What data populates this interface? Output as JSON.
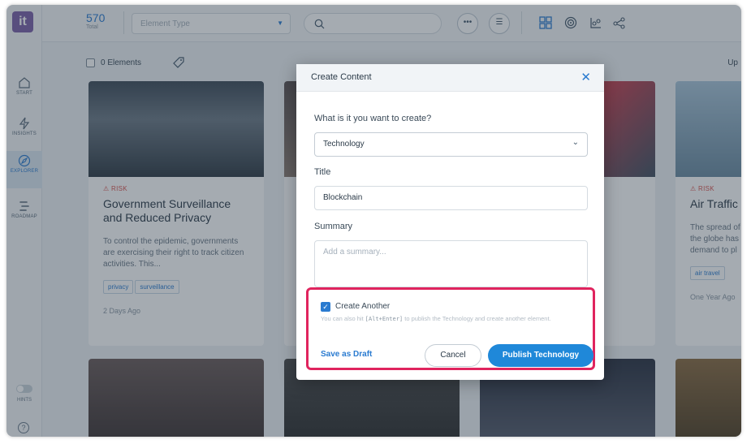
{
  "app": {
    "logo": "it"
  },
  "sidebar": {
    "items": [
      {
        "label": "START",
        "icon": "home-icon"
      },
      {
        "label": "INSIGHTS",
        "icon": "lightning-icon"
      },
      {
        "label": "EXPLORER",
        "icon": "compass-icon"
      },
      {
        "label": "ROADMAP",
        "icon": "roadmap-icon"
      }
    ],
    "hints_label": "HINTS",
    "help_label": "?"
  },
  "topbar": {
    "count": "570",
    "count_label": "Total",
    "element_type_placeholder": "Element Type"
  },
  "toolbar": {
    "elements_label": "0 Elements",
    "right_text": "Up"
  },
  "cards": [
    {
      "category": "RISK",
      "title": "Government Surveillance and Reduced Privacy",
      "description": "To control the epidemic, governments are exercising their right to track citizen activities. This...",
      "tags": [
        "privacy",
        "surveillance"
      ],
      "date": "2 Days Ago"
    },
    {
      "category": "RISK",
      "title": "Air Traffic",
      "description": "The spread of the globe has demand to pl",
      "tags": [
        "air travel"
      ],
      "date": "One Year Ago"
    }
  ],
  "modal": {
    "title": "Create Content",
    "question": "What is it you want to create?",
    "type_value": "Technology",
    "title_label": "Title",
    "title_value": "Blockchain",
    "summary_label": "Summary",
    "summary_placeholder": "Add a summary...",
    "create_another_label": "Create Another",
    "hint_prefix": "You can also hit",
    "hint_key": "[Alt+Enter]",
    "hint_suffix": "to publish the Technology and create another element.",
    "save_draft_label": "Save as Draft",
    "cancel_label": "Cancel",
    "publish_label": "Publish Technology"
  },
  "colors": {
    "accent": "#1f88d9",
    "highlight": "#e0245e",
    "risk": "#d9534f"
  }
}
